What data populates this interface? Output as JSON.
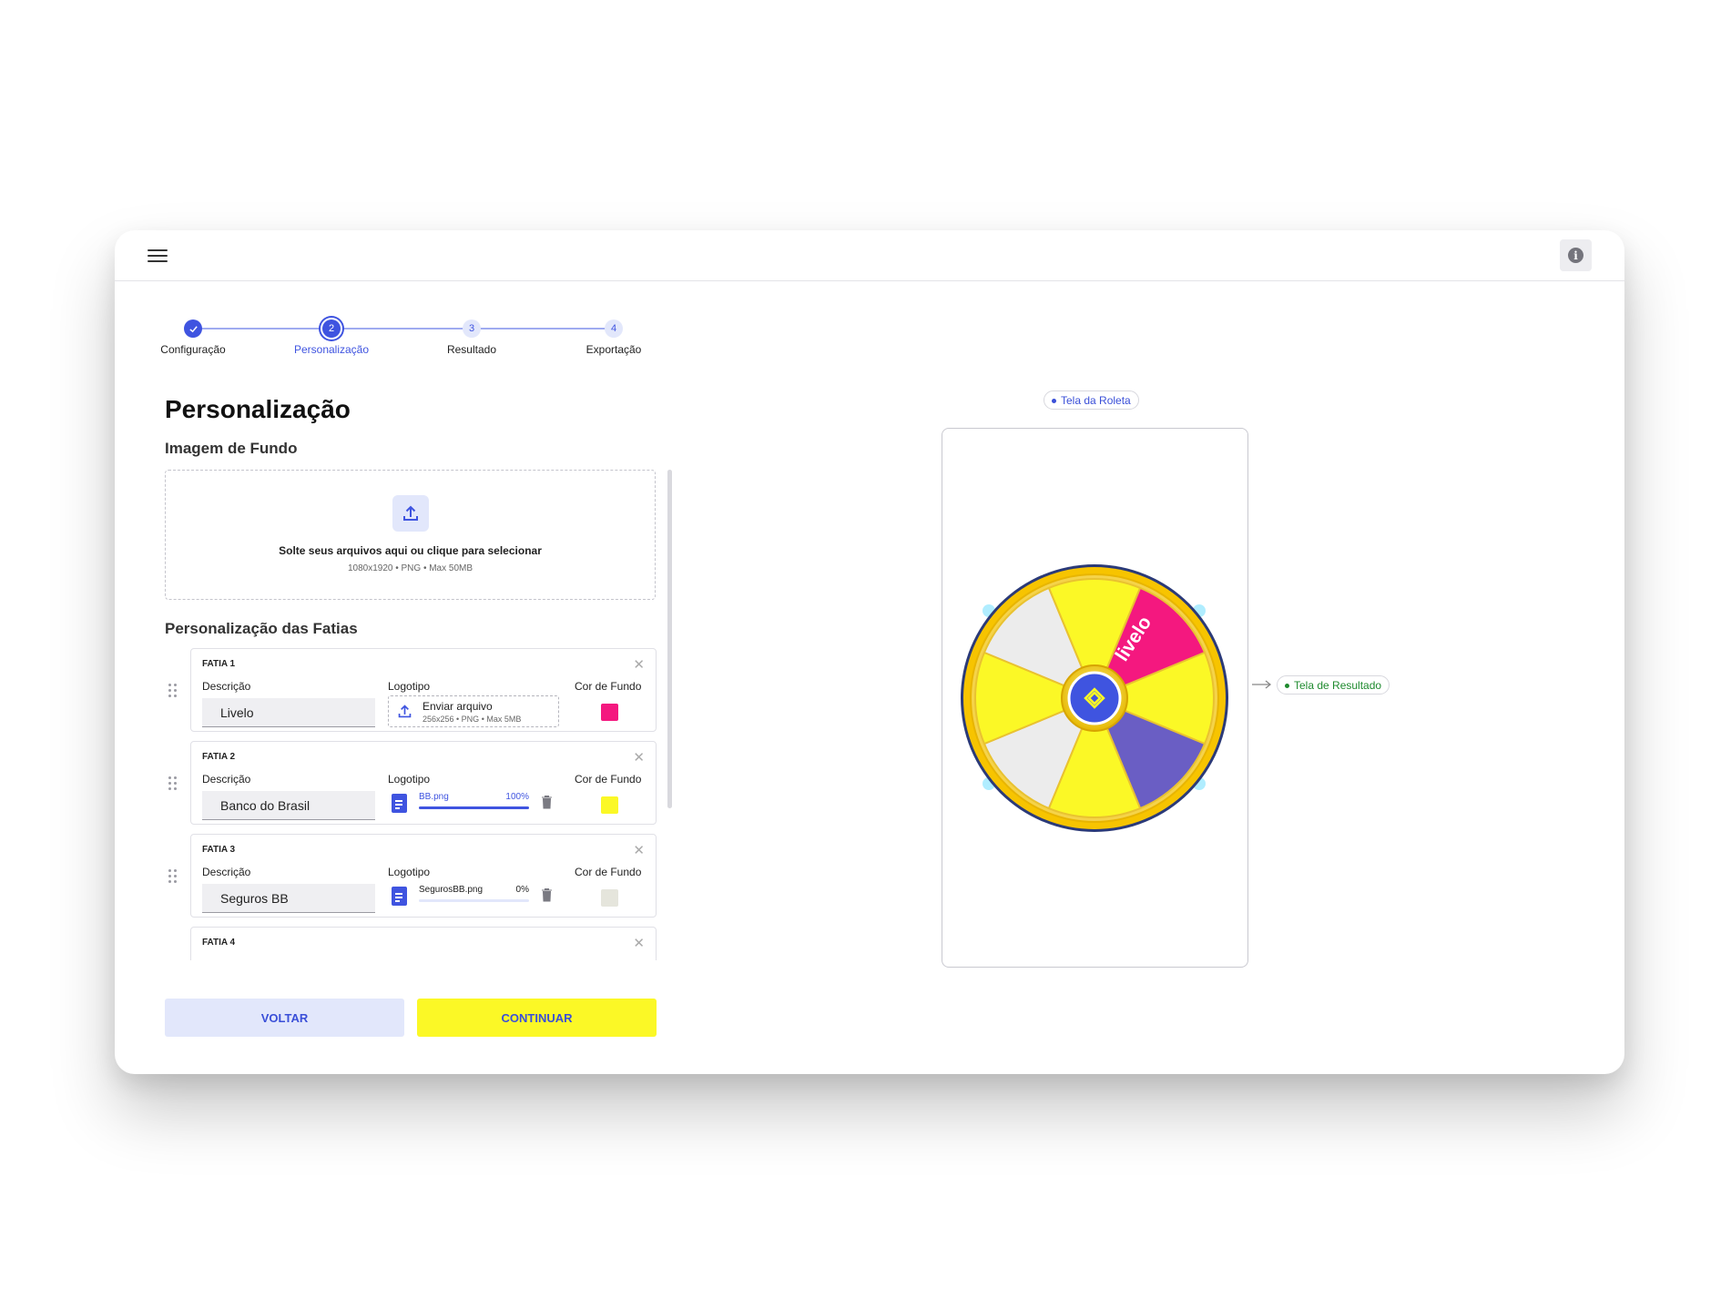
{
  "stepper": {
    "steps": [
      {
        "label": "Configuração",
        "num": "✓",
        "state": "done"
      },
      {
        "label": "Personalização",
        "num": "2",
        "state": "active"
      },
      {
        "label": "Resultado",
        "num": "3",
        "state": "todo"
      },
      {
        "label": "Exportação",
        "num": "4",
        "state": "todo"
      }
    ]
  },
  "page": {
    "title": "Personalização",
    "background_section": "Imagem de Fundo",
    "slices_section": "Personalização das Fatias"
  },
  "dropzone": {
    "text": "Solte seus arquivos aqui ou clique para selecionar",
    "subtext": "1080x1920 • PNG • Max 50MB"
  },
  "slice_labels": {
    "description": "Descrição",
    "logo": "Logotipo",
    "background_color": "Cor de Fundo"
  },
  "slices": [
    {
      "title": "FATIA 1",
      "description": "Livelo",
      "color": "#f4187f",
      "upload": {
        "title": "Enviar arquivo",
        "subtitle": "256x256 • PNG • Max 5MB"
      }
    },
    {
      "title": "FATIA 2",
      "description": "Banco do Brasil",
      "color": "#fbf826",
      "file": {
        "name": "BB.png",
        "progress_label": "100%",
        "progress": 1.0
      }
    },
    {
      "title": "FATIA 3",
      "description": "Seguros BB",
      "color": "#e5e5dc",
      "file": {
        "name": "SegurosBB.png",
        "progress_label": "0%",
        "progress": 0.0
      }
    },
    {
      "title": "FATIA 4",
      "description": "",
      "color": ""
    }
  ],
  "buttons": {
    "back": "VOLTAR",
    "continue": "CONTINUAR"
  },
  "preview": {
    "roulette_label": "Tela da Roleta",
    "result_label": "Tela de Resultado",
    "wheel_brand_text": "livelo",
    "wheel_segment_colors": [
      "#fbf826",
      "#f4187f",
      "#fbf826",
      "#6a5ec4",
      "#fbf826",
      "#ececec",
      "#fbf826",
      "#ececec"
    ]
  },
  "colors": {
    "accent": "#3f54e0",
    "primary_yellow": "#fbf826",
    "back_button": "#e2e7fb",
    "result_green": "#1e8a2e"
  }
}
